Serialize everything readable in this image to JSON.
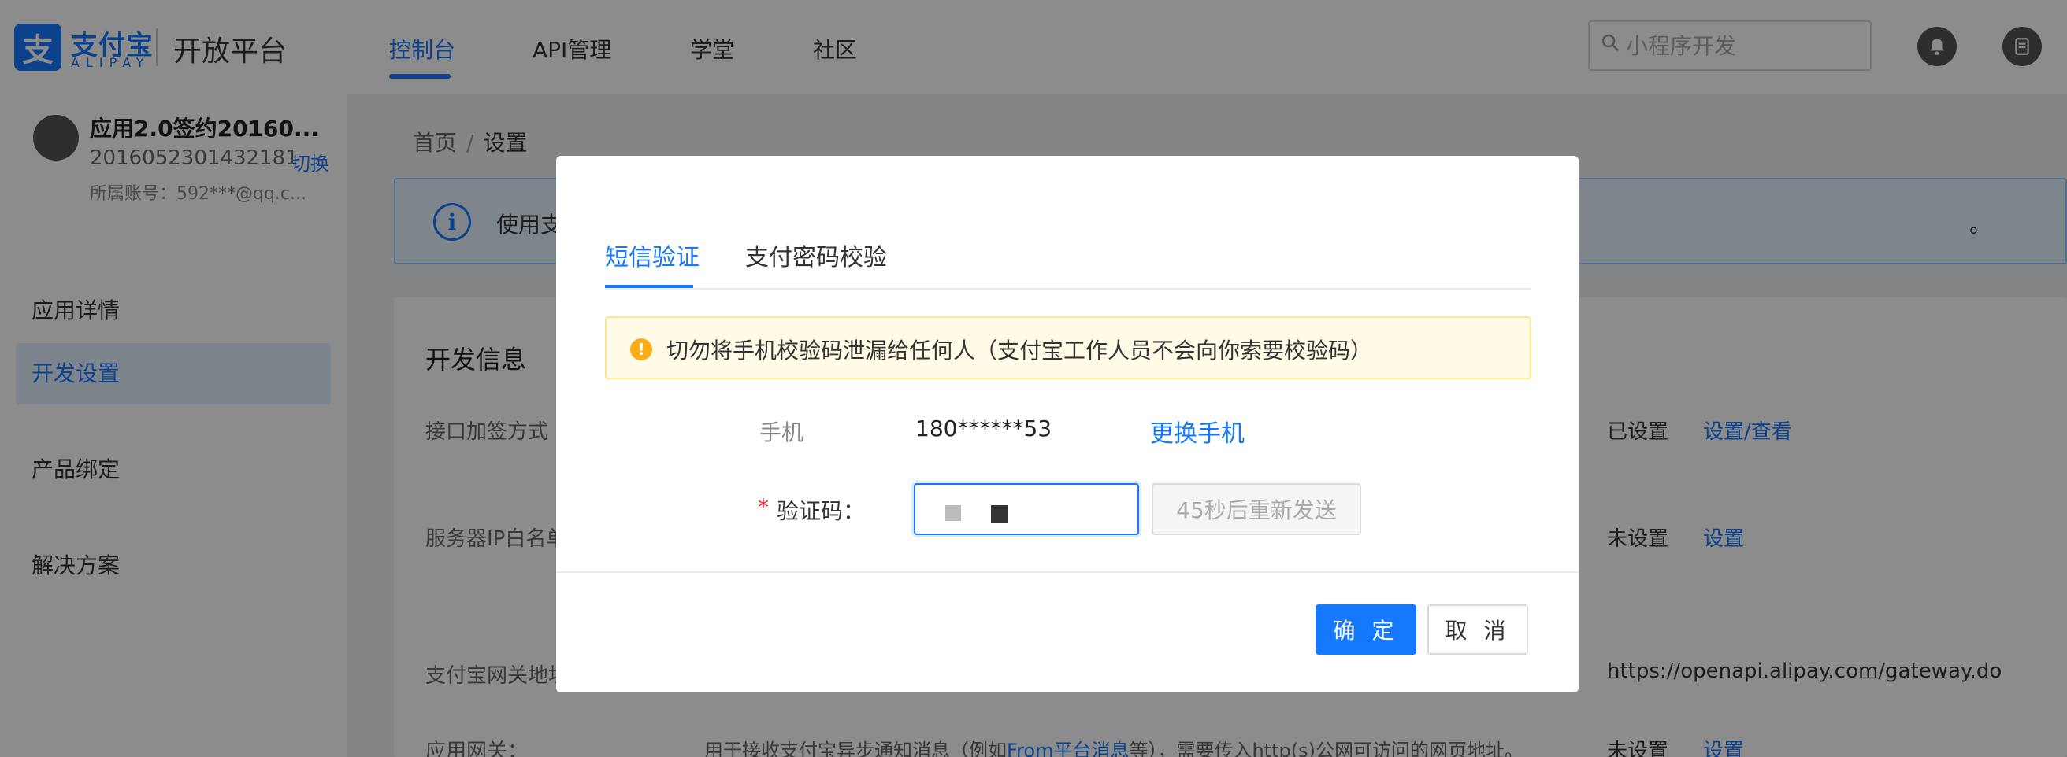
{
  "header": {
    "logo_glyph": "支",
    "logo_cn": "支付宝",
    "logo_en": "ALIPAY",
    "platform_name": "开放平台",
    "nav": [
      {
        "label": "控制台",
        "active": true
      },
      {
        "label": "API管理",
        "active": false
      },
      {
        "label": "学堂",
        "active": false
      },
      {
        "label": "社区",
        "active": false
      }
    ],
    "search_placeholder": "小程序开发"
  },
  "sidebar": {
    "app_name": "应用2.0签约20160...",
    "app_id": "2016052301432181",
    "switch_label": "切换",
    "account": "所属账号：592***@qq.c...",
    "items": [
      {
        "label": "应用详情",
        "active": false
      },
      {
        "label": "开发设置",
        "active": true
      },
      {
        "label": "产品绑定",
        "active": false
      },
      {
        "label": "解决方案",
        "active": false
      }
    ]
  },
  "breadcrumb": {
    "home": "首页",
    "separator": "/",
    "current": "设置"
  },
  "banner": {
    "icon": "i",
    "text_visible": "使用支",
    "text_tail": "。"
  },
  "dev_info": {
    "title": "开发信息",
    "rows": [
      {
        "label": "接口加签方式（",
        "status": "已设置",
        "link": "设置/查看"
      },
      {
        "label": "服务器IP白名单",
        "status": "未设置",
        "link": "设置"
      },
      {
        "label": "支付宝网关地址",
        "value": "https://openapi.alipay.com/gateway.do"
      },
      {
        "label": "应用网关：",
        "desc_before": "用于接收支付宝异步通知消息（例如",
        "desc_link": "From平台消息",
        "desc_after": "等），需要传入http(s)公网可访问的网页地址。",
        "status": "未设置",
        "link": "设置"
      }
    ]
  },
  "modal": {
    "tabs": [
      {
        "label": "短信验证",
        "active": true
      },
      {
        "label": "支付密码校验",
        "active": false
      }
    ],
    "warning_icon": "!",
    "warning": "切勿将手机校验码泄漏给任何人（支付宝工作人员不会向你索要校验码）",
    "phone_label": "手机",
    "phone_value": "180******53",
    "change_phone": "更换手机",
    "code_required_mark": "*",
    "code_label": "验证码：",
    "resend_label": "45秒后重新发送",
    "confirm_label": "确 定",
    "cancel_label": "取 消"
  },
  "colors": {
    "primary": "#1677ff",
    "warning_bg": "#fffbe6",
    "overlay": "rgba(0,0,0,0.45)"
  }
}
